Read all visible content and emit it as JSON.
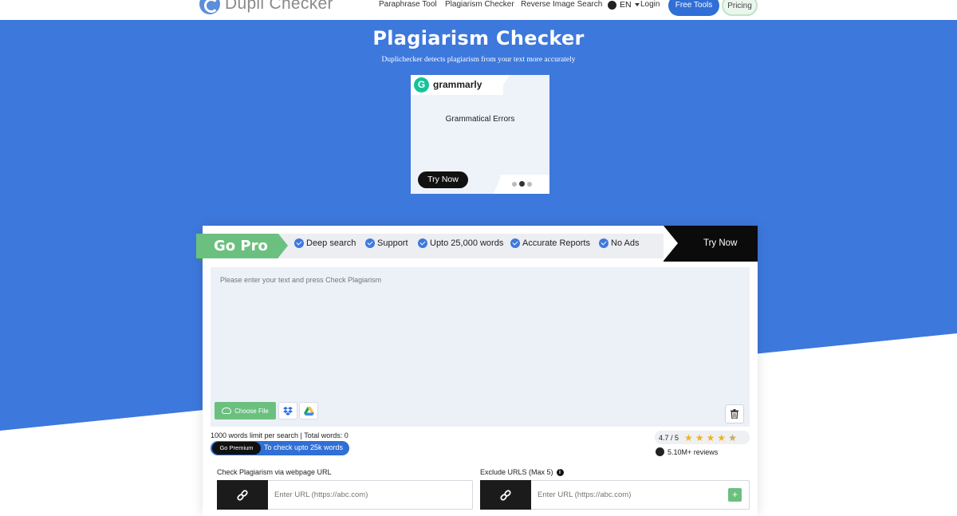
{
  "header": {
    "logo_text": "Dupli Checker",
    "nav": [
      "Paraphrase Tool",
      "Plagiarism Checker",
      "Reverse Image Search"
    ],
    "language": "EN",
    "login": "Login",
    "free_tools": "Free Tools",
    "pricing": "Pricing"
  },
  "hero": {
    "title": "Plagiarism Checker",
    "subtitle": "Duplichecker detects plagiarism from your text more accurately"
  },
  "ad": {
    "brand": "grammarly",
    "brand_letter": "G",
    "headline": "Grammatical Errors",
    "cta": "Try Now"
  },
  "pro": {
    "badge": "Go Pro",
    "features": [
      "Deep search",
      "Support",
      "Upto 25,000 words",
      "Accurate Reports",
      "No Ads"
    ],
    "cta": "Try Now"
  },
  "editor": {
    "placeholder": "Please enter your text and press Check Plagiarism",
    "choose_file": "Choose File",
    "limit_text": "1000 words limit per search | Total words: 0"
  },
  "premium": {
    "button": "Go Premium",
    "text": "To check upto 25k words"
  },
  "rating": {
    "value": "4.7 / 5",
    "stars": 4.7,
    "reviews": "5.10M+ reviews"
  },
  "url_check": {
    "label": "Check Plagiarism via webpage URL",
    "placeholder": "Enter URL (https://abc.com)"
  },
  "exclude": {
    "label": "Exclude URLS (Max 5)",
    "placeholder": "Enter URL (https://abc.com)",
    "add": "+"
  },
  "colors": {
    "blue": "#3d78dc",
    "green": "#6cc07f",
    "dark": "#111111"
  }
}
